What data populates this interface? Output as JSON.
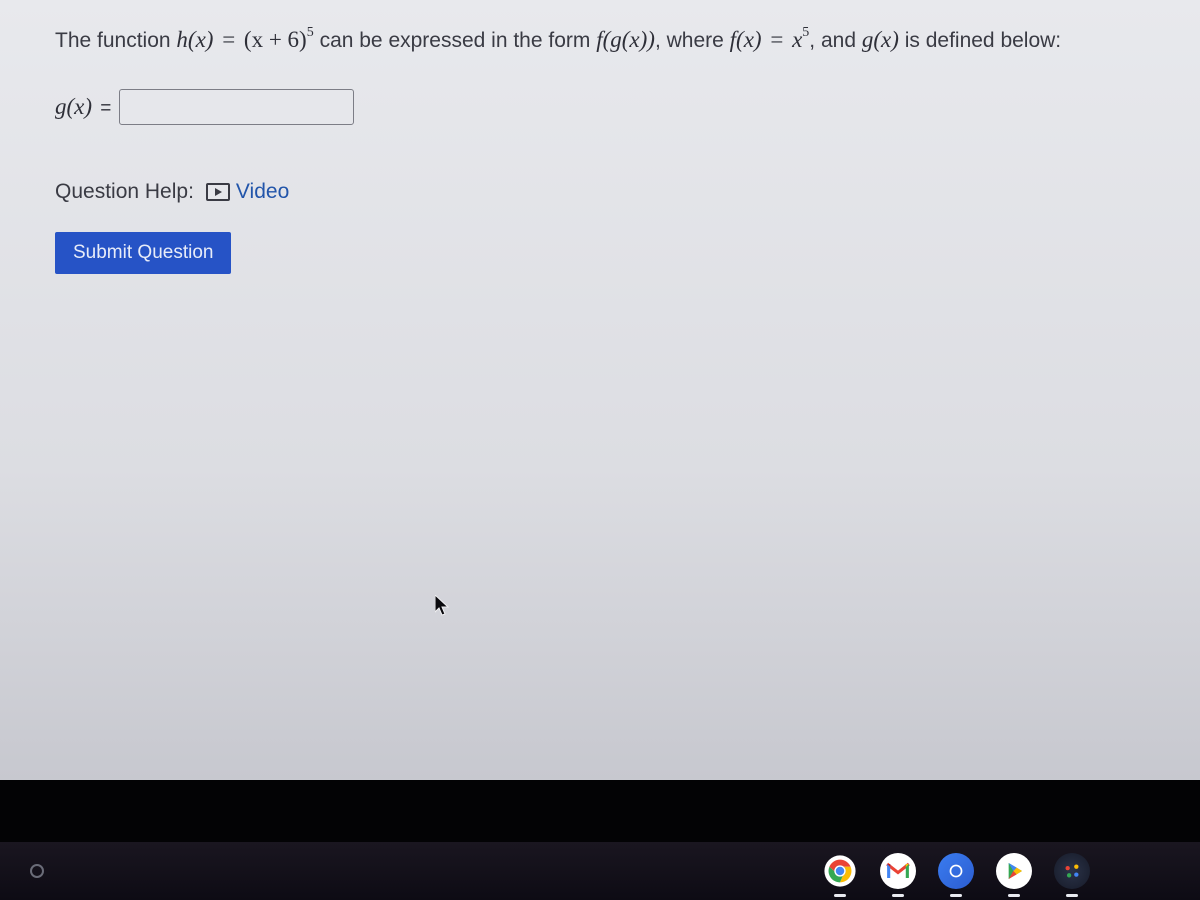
{
  "question": {
    "prefix": "The function ",
    "h_expr_lhs": "h(x)",
    "h_expr_eq": " = ",
    "h_expr_rhs_base": "(x + 6)",
    "h_expr_rhs_exp": "5",
    "mid1": " can be expressed in the form ",
    "fgx": "f(g(x))",
    "mid2": ", where ",
    "f_lhs": "f(x)",
    "f_eq": " = ",
    "f_rhs_base": "x",
    "f_rhs_exp": "5",
    "mid3": ", and ",
    "g_expr": "g(x)",
    "suffix": " is defined below:"
  },
  "answer": {
    "label_func": "g(x)",
    "label_eq": " =",
    "value": "",
    "placeholder": ""
  },
  "help": {
    "label": "Question Help:",
    "video_text": "Video"
  },
  "submit": {
    "label": "Submit Question"
  },
  "taskbar": {
    "items": [
      "chrome",
      "gmail",
      "files",
      "play",
      "settings"
    ]
  }
}
